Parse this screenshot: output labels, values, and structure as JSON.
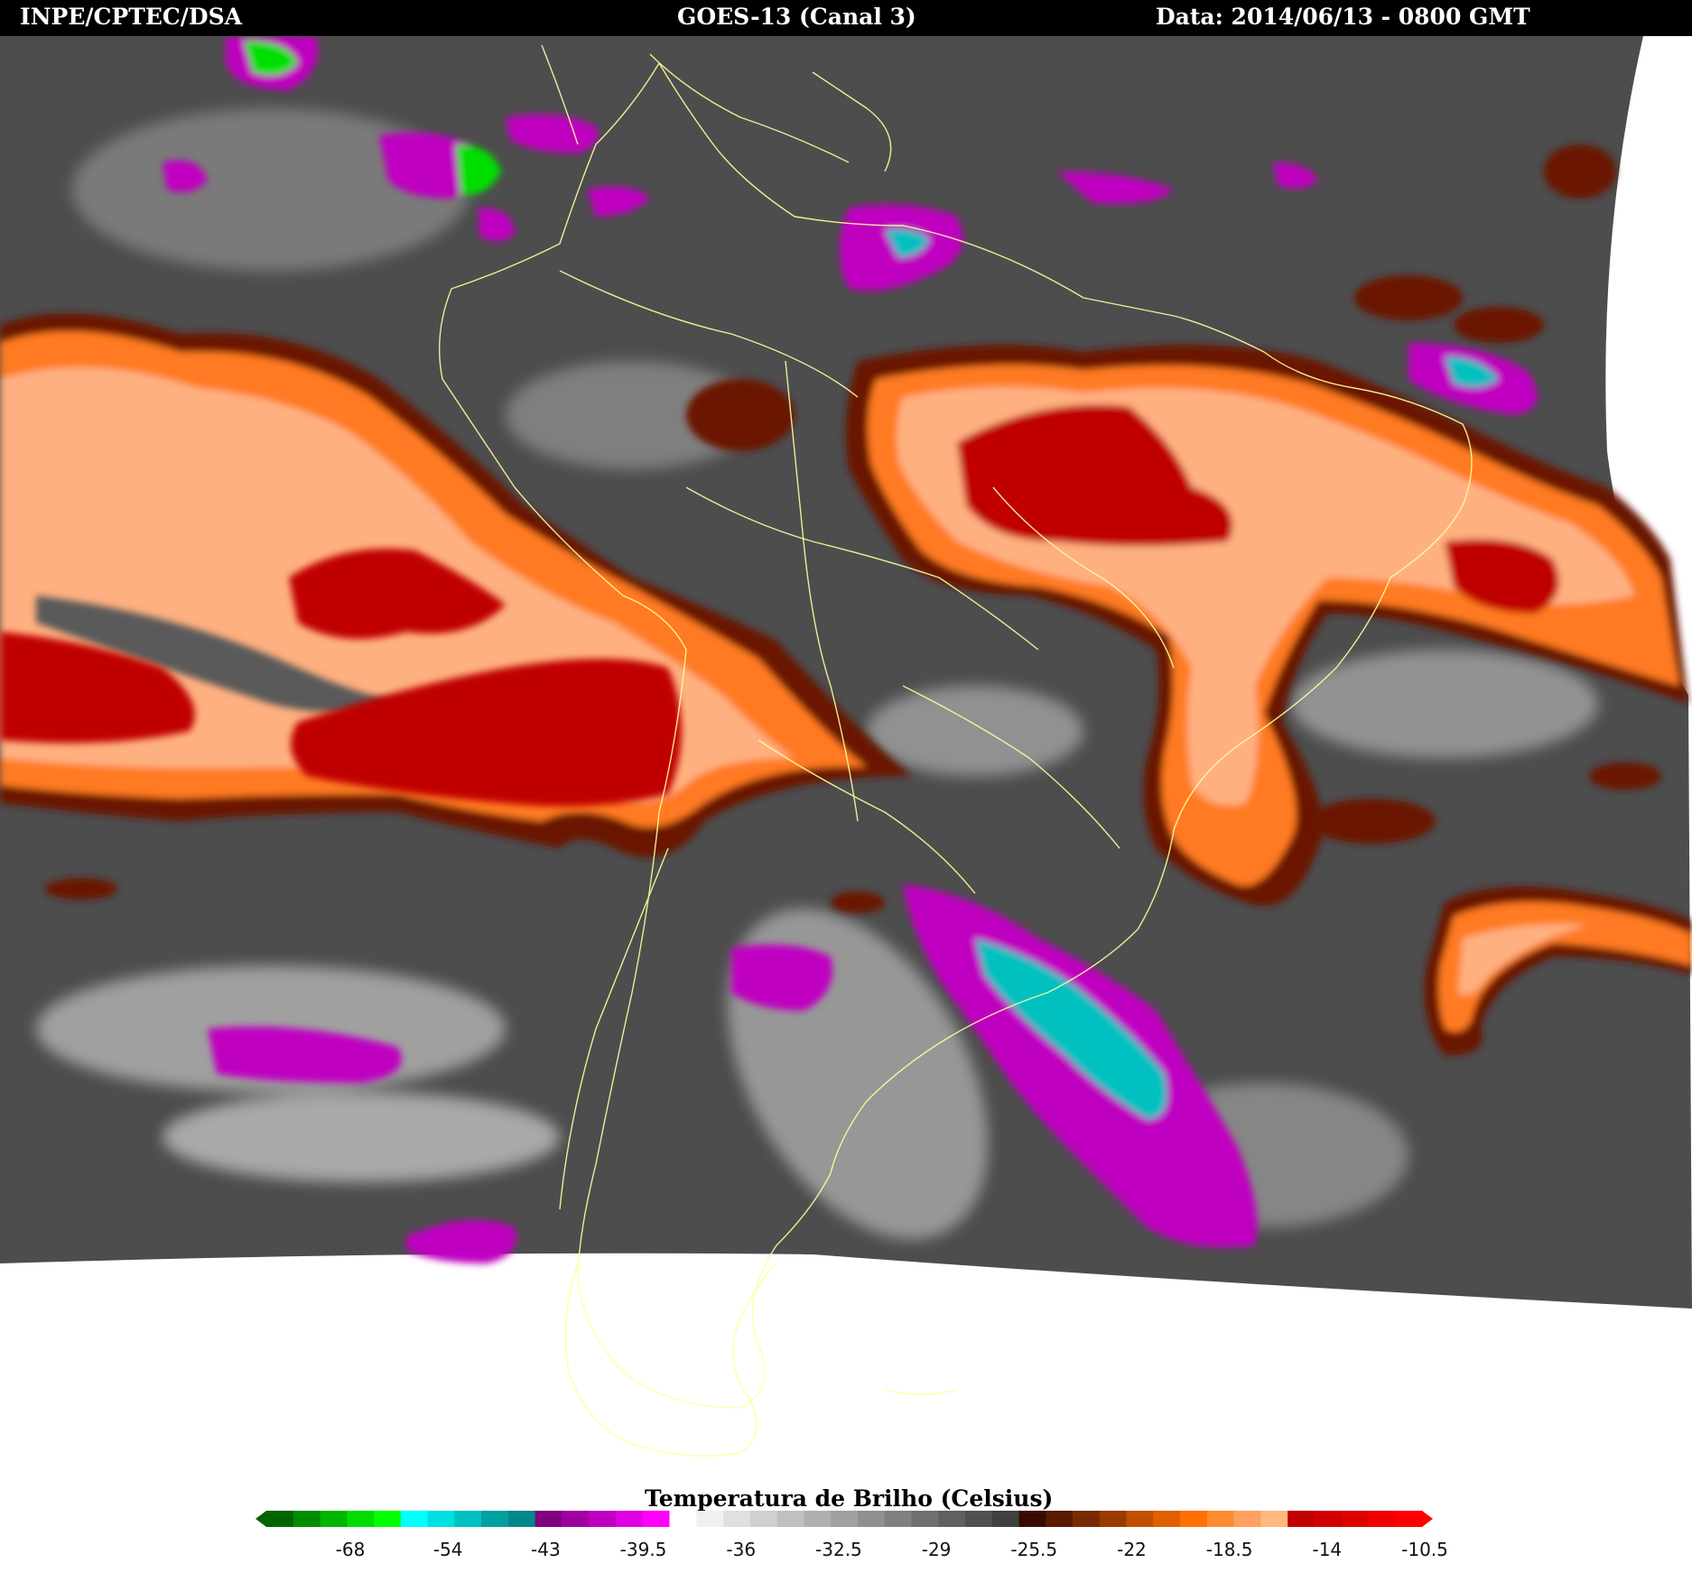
{
  "header": {
    "left": "INPE/CPTEC/DSA",
    "center": "GOES-13 (Canal 3)",
    "right": "Data: 2014/06/13 - 0800 GMT"
  },
  "legend": {
    "title": "Temperatura de Brilho (Celsius)",
    "ticks": [
      "-68",
      "-54",
      "-43",
      "-39.5",
      "-36",
      "-32.5",
      "-29",
      "-25.5",
      "-22",
      "-18.5",
      "-14",
      "-10.5"
    ],
    "colors": [
      "#006400",
      "#008c00",
      "#00b400",
      "#00dc00",
      "#00ff00",
      "#00ffff",
      "#00e0e0",
      "#00c0c0",
      "#00a0a0",
      "#008888",
      "#800080",
      "#a000a0",
      "#c000c0",
      "#e000e0",
      "#ff00ff",
      "#ffffff",
      "#f0f0f0",
      "#e0e0e0",
      "#d0d0d0",
      "#c0c0c0",
      "#b0b0b0",
      "#a0a0a0",
      "#909090",
      "#808080",
      "#707070",
      "#606060",
      "#505050",
      "#404040",
      "#3a0a00",
      "#5a1a00",
      "#7a2a00",
      "#9a3a00",
      "#c05000",
      "#e06000",
      "#ff7000",
      "#ff8c30",
      "#ffa060",
      "#ffb880",
      "#c00000",
      "#d00000",
      "#e00000",
      "#f00000",
      "#ff0000"
    ]
  },
  "map": {
    "background_color": "#4a4a4a",
    "cold_cloud_color": "#d8d8d8",
    "warm_orange": "#ff8c30",
    "warm_light": "#ffb080",
    "warm_red": "#c80000",
    "warm_dark": "#6a1800",
    "deep_convection_magenta": "#c000c0",
    "deep_convection_cyan": "#00c0c0",
    "deep_convection_green": "#00e000",
    "coastline_color": "#ffffa0"
  }
}
